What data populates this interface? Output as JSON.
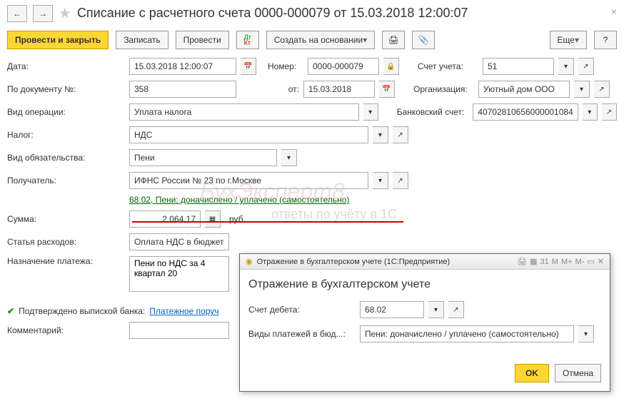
{
  "title": "Списание с расчетного счета 0000-000079 от 15.03.2018 12:00:07",
  "toolbar": {
    "post_close": "Провести и закрыть",
    "save": "Записать",
    "post": "Провести",
    "create_based": "Создать на основании",
    "more": "Еще"
  },
  "fields": {
    "date_label": "Дата:",
    "date": "15.03.2018 12:00:07",
    "number_label": "Номер:",
    "number": "0000-000079",
    "account_label": "Счет учета:",
    "account": "51",
    "doc_num_label": "По документу №:",
    "doc_num": "358",
    "from_label": "от:",
    "from_date": "15.03.2018",
    "org_label": "Организация:",
    "org": "Уютный дом ООО",
    "op_type_label": "Вид операции:",
    "op_type": "Уплата налога",
    "bank_acc_label": "Банковский счет:",
    "bank_acc": "40702810656000001084",
    "tax_label": "Налог:",
    "tax": "НДС",
    "obligation_label": "Вид обязательства:",
    "obligation": "Пени",
    "recipient_label": "Получатель:",
    "recipient": "ИФНС России № 23 по г.Москве",
    "link_text": "68.02, Пени: доначислено / уплачено (самостоятельно)",
    "sum_label": "Сумма:",
    "sum": "2 064,17",
    "currency": "руб.",
    "expense_label": "Статья расходов:",
    "expense": "Оплата НДС в бюджет",
    "purpose_label": "Назначение платежа:",
    "purpose": "Пени по НДС за 4 квартал 20",
    "confirmed": "Подтверждено выпиской банка:",
    "payment_order": "Платежное поруч",
    "comment_label": "Комментарий:"
  },
  "popup": {
    "window_title": "Отражение в бухгалтерском учете  (1С:Предприятие)",
    "heading": "Отражение в бухгалтерском учете",
    "debit_label": "Счет дебета:",
    "debit": "68.02",
    "payment_type_label": "Виды платежей в бюд...:",
    "payment_type": "Пени: доначислено / уплачено (самостоятельно)",
    "ok": "OK",
    "cancel": "Отмена"
  },
  "watermark": "БухЭксперт8",
  "watermark2": "ответы по учёту в 1С"
}
